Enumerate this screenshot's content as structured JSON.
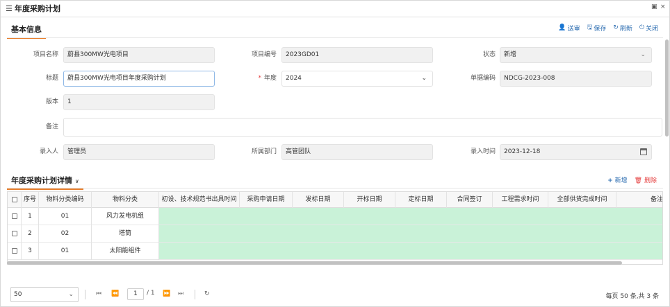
{
  "window": {
    "title": "年度采购计划",
    "menu_icon": "☰",
    "restore_icon": "▣",
    "close_icon": "×"
  },
  "basic": {
    "title": "基本信息",
    "toolbar": {
      "submit": "送审",
      "save": "保存",
      "refresh": "刷新",
      "close": "关闭",
      "submit_icon": "👤",
      "save_icon": "🖫",
      "refresh_icon": "↻",
      "close_icon": "⏻"
    }
  },
  "form": {
    "project_name": {
      "label": "项目名称",
      "value": "蔚县300MW光电项目"
    },
    "project_code": {
      "label": "项目编号",
      "value": "2023GD01"
    },
    "status": {
      "label": "状态",
      "value": "新增"
    },
    "title": {
      "label": "标题",
      "value": "蔚县300MW光电项目年度采购计划"
    },
    "year": {
      "label": "年度",
      "value": "2024",
      "required": "*"
    },
    "doc_code": {
      "label": "单据编码",
      "value": "NDCG-2023-008"
    },
    "version": {
      "label": "版本",
      "value": "1"
    },
    "remark": {
      "label": "备注",
      "value": ""
    },
    "entered_by": {
      "label": "录入人",
      "value": "管理员"
    },
    "department": {
      "label": "所属部门",
      "value": "高管团队"
    },
    "entry_time": {
      "label": "录入时间",
      "value": "2023-12-18"
    }
  },
  "detail": {
    "title": "年度采购计划详情",
    "title_caret": "∨",
    "add": "新增",
    "delete": "删除",
    "add_icon": "+",
    "delete_icon": "🗑",
    "columns": [
      "序号",
      "物料分类编码",
      "物料分类",
      "初设、技术规范书出具时间",
      "采购申请日期",
      "发标日期",
      "开标日期",
      "定标日期",
      "合同签订",
      "工程需求时间",
      "全部供货完成时间",
      "备注"
    ],
    "rows": [
      {
        "no": "1",
        "code": "01",
        "category": "风力发电机组"
      },
      {
        "no": "2",
        "code": "02",
        "category": "塔筒"
      },
      {
        "no": "3",
        "code": "01",
        "category": "太阳能组件"
      }
    ]
  },
  "pager": {
    "page_size": "50",
    "current_page": "1",
    "total_pages": "/ 1",
    "summary": "每页 50 条,共 3 条",
    "first": "⏮",
    "prev": "⏪",
    "next": "⏩",
    "last": "⏭",
    "refresh": "↻"
  }
}
